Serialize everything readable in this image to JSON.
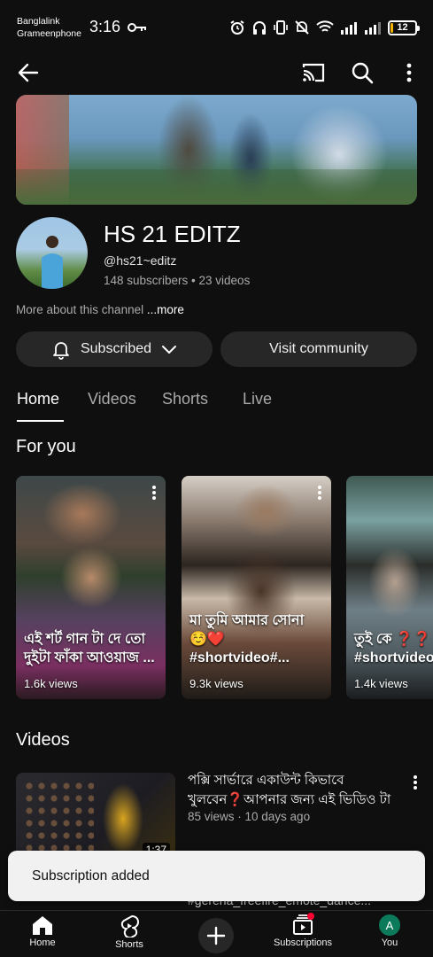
{
  "status_bar": {
    "carrier_1": "Banglalink",
    "carrier_2": "Grameenphone",
    "time": "3:16",
    "battery": "12",
    "battery_level_percent": 12
  },
  "app_bar": {
    "icons": [
      "back-arrow-icon",
      "cast-icon",
      "search-icon",
      "more-vert-icon"
    ]
  },
  "channel": {
    "name": "HS 21 EDITZ",
    "handle": "@hs21~editz",
    "stats": "148 subscribers • 23 videos",
    "about_text": "More about this channel",
    "about_more": "...more"
  },
  "buttons": {
    "subscribed": "Subscribed",
    "community": "Visit community"
  },
  "tabs": [
    {
      "label": "Home",
      "active": true
    },
    {
      "label": "Videos",
      "active": false
    },
    {
      "label": "Shorts",
      "active": false
    },
    {
      "label": "Live",
      "active": false
    }
  ],
  "for_you": {
    "title": "For you",
    "shorts": [
      {
        "caption": "এই শর্ট গান টা দে তো দুইটা ফাঁকা আওয়াজ ...",
        "views": "1.6k views"
      },
      {
        "caption": "মা তুমি আমার সোনা ☺️❤️ #shortvideo#...",
        "views": "9.3k views"
      },
      {
        "caption": "তুই কে ❓❓ #shortvideo",
        "views": "1.4k views"
      }
    ]
  },
  "videos": {
    "title": "Videos",
    "items": [
      {
        "title": "পক্সি সার্ভারে একাউন্ট কিভাবে খুলবেন❓আপনার জন্য এই ভিডিও টা",
        "meta": "85 views · 10 days ago",
        "duration": "1:37",
        "tags": "#gerena_freefire_emote_dance..."
      }
    ]
  },
  "toast": {
    "message": "Subscription added"
  },
  "bottom_nav": {
    "items": [
      {
        "label": "Home",
        "icon": "home-icon"
      },
      {
        "label": "Shorts",
        "icon": "shorts-icon"
      },
      {
        "label": "",
        "icon": "create-icon"
      },
      {
        "label": "Subscriptions",
        "icon": "subscriptions-icon"
      },
      {
        "label": "You",
        "icon": "avatar-icon",
        "avatar_letter": "A"
      }
    ]
  },
  "colors": {
    "background": "#0f0f0f",
    "chip": "#272727",
    "secondary_text": "#aaaaaa",
    "battery": "#f4b400",
    "notification_dot": "#ff0033",
    "you_avatar": "#0b7a5a"
  }
}
